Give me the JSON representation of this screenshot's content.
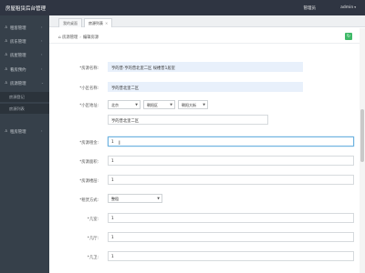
{
  "topbar": {
    "brand": "房屋租赁后台管理",
    "admin_link": "管理员",
    "user": "admin",
    "user_caret": "▾"
  },
  "sidebar": {
    "items": [
      {
        "label": "租客管理",
        "icon": "user-icon",
        "chev": "‹"
      },
      {
        "label": "房东管理",
        "icon": "user-icon",
        "chev": "‹"
      },
      {
        "label": "房屋管理",
        "icon": "user-icon",
        "chev": "‹"
      },
      {
        "label": "看房预约",
        "icon": "user-icon",
        "chev": "‹"
      },
      {
        "label": "房源管理",
        "icon": "user-icon",
        "chev": "⌄"
      },
      {
        "label": "租房管理",
        "icon": "user-icon",
        "chev": "‹"
      }
    ],
    "subitems": [
      {
        "label": "房源登记"
      },
      {
        "label": "房源列表"
      }
    ]
  },
  "tabs": [
    {
      "label": "我的桌面",
      "close": ""
    },
    {
      "label": "房源列表",
      "close": "×"
    }
  ],
  "breadcrumb": {
    "home_icon": "home-icon",
    "first": "房源管理",
    "second": "编辑房源"
  },
  "form": {
    "house_name_label": "*房源名称:",
    "house_name_value": "亨的普·亨的普北里二区 绥楼普1居室",
    "community_label": "*小区名称:",
    "community_value": "亨的普北里二区",
    "address_label": "*小区地址:",
    "province": "北京",
    "district": "朝阳区",
    "street": "朝阳大街",
    "address_value": "亨的普北里二区",
    "rent_label": "*房源租金:",
    "rent_value": "1",
    "area_label": "*房源面积:",
    "area_value": "1",
    "floor_label": "*房源楼层:",
    "floor_value": "1",
    "rent_type_label": "*租赁方式:",
    "rent_type_value": "整租",
    "room_label": "*几室:",
    "room_value": "1",
    "hall_label": "*几厅:",
    "hall_value": "1",
    "bath_label": "*几卫:",
    "bath_value": "1"
  },
  "colors": {
    "topbar": "#2f3542",
    "sidebar": "#36404a",
    "accent_green": "#3fb968",
    "readonly_field": "#e8f0fb",
    "required_star": "#e04a4a"
  }
}
